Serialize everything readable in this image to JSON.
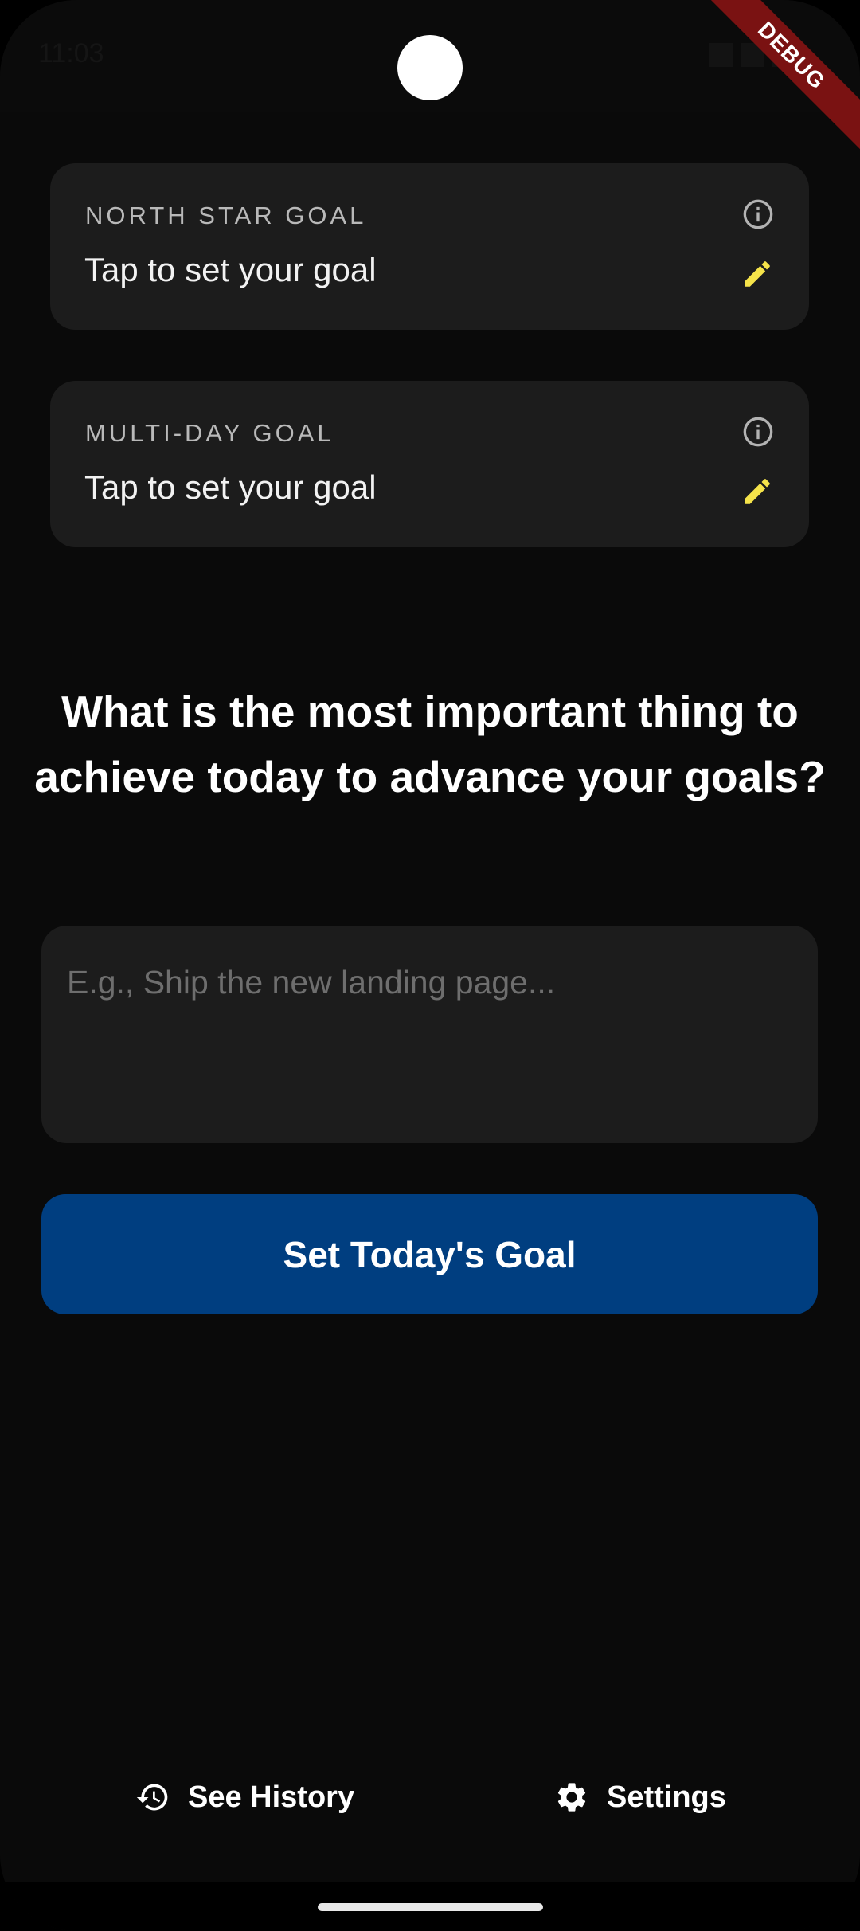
{
  "status_bar": {
    "time": "11:03"
  },
  "debug_banner": "DEBUG",
  "north_star_goal": {
    "label": "NORTH STAR GOAL",
    "value": "Tap to set your goal"
  },
  "multi_day_goal": {
    "label": "MULTI-DAY GOAL",
    "value": "Tap to set your goal"
  },
  "prompt": {
    "question": "What is the most important thing to achieve today to advance your goals?"
  },
  "today_goal_input": {
    "value": "",
    "placeholder": "E.g., Ship the new landing page..."
  },
  "primary_action": {
    "label": "Set Today's Goal"
  },
  "bottom_actions": {
    "history_label": "See History",
    "settings_label": "Settings"
  },
  "colors": {
    "background": "#0a0a0a",
    "card": "#1c1c1c",
    "accent_edit": "#f5e34a",
    "primary_button": "#003e80"
  }
}
